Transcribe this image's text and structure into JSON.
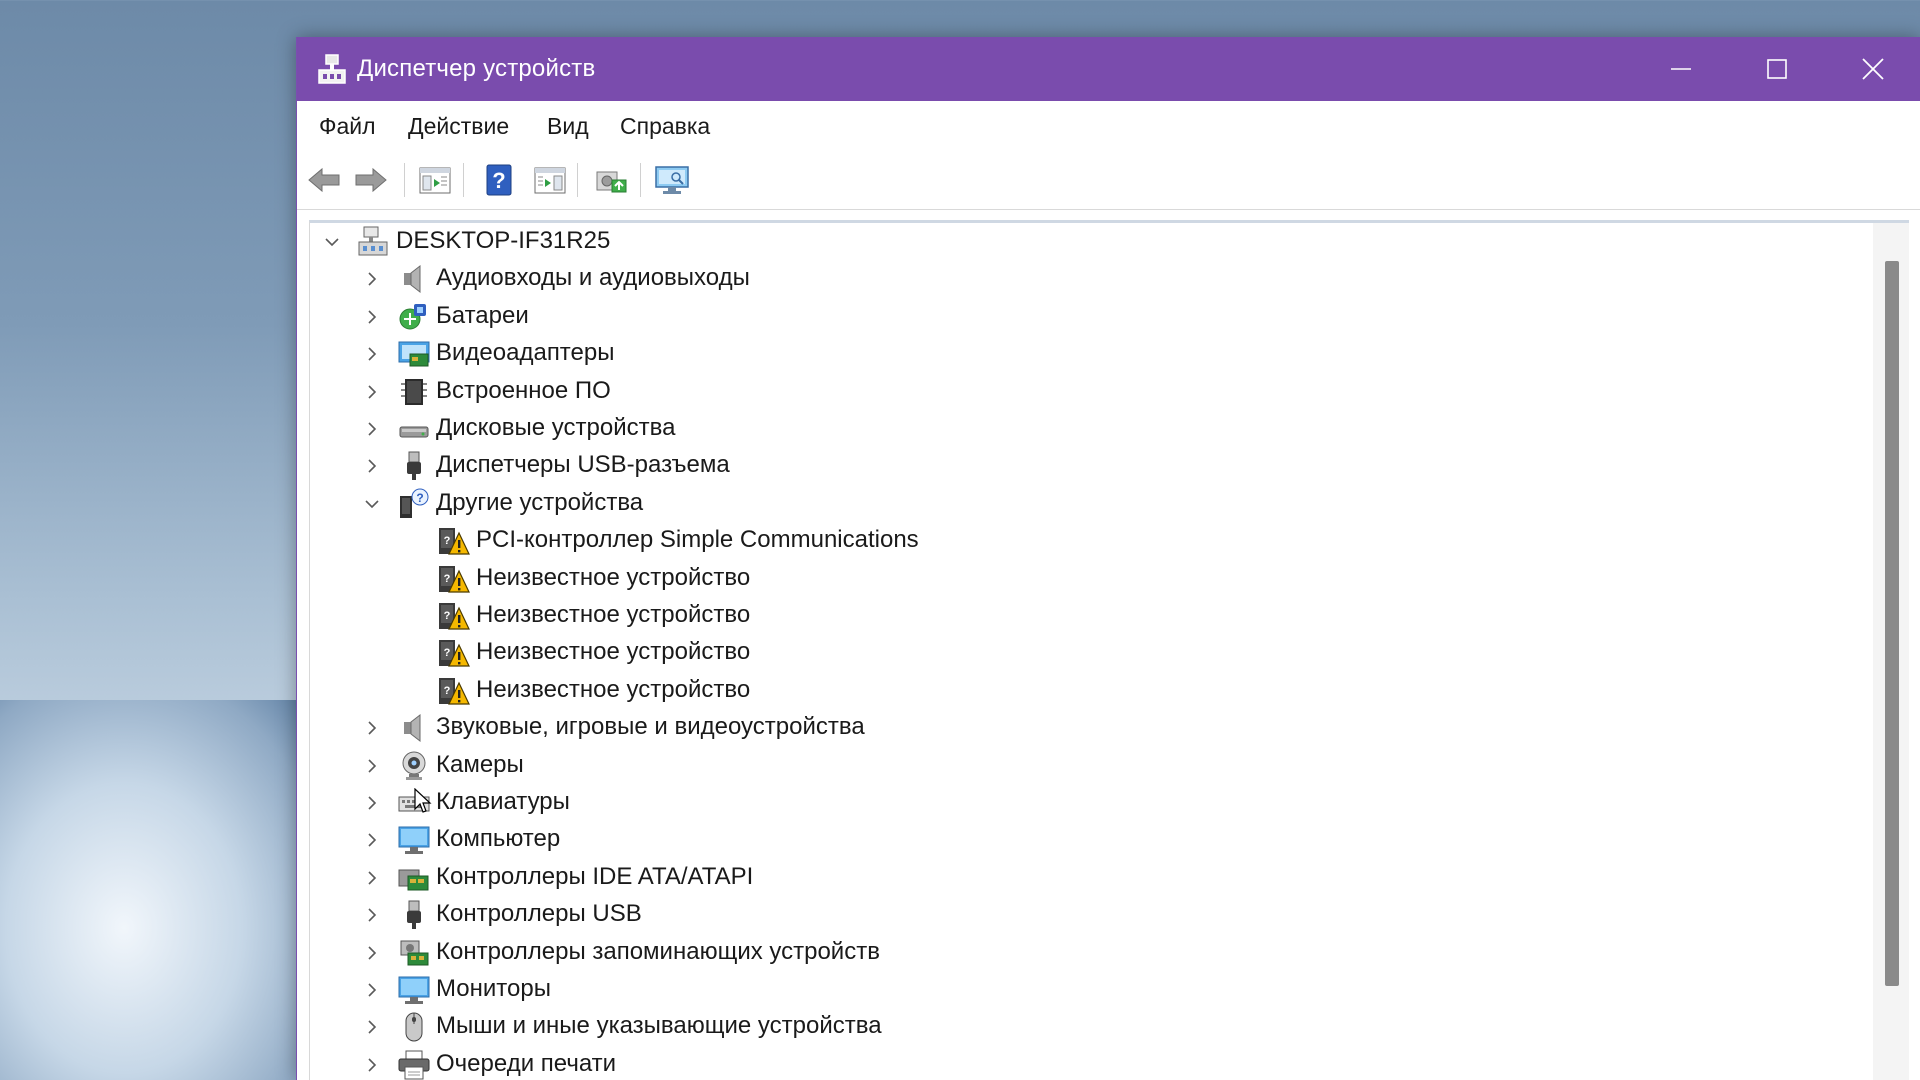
{
  "window": {
    "title": "Диспетчер устройств",
    "icon": "device-manager-icon",
    "accent": "#7a4cad"
  },
  "menu": [
    "Файл",
    "Действие",
    "Вид",
    "Справка"
  ],
  "toolbar": [
    "back-arrow-icon",
    "forward-arrow-icon",
    "properties-icon",
    "help-icon",
    "show-hidden-icon",
    "update-driver-icon",
    "scan-hardware-icon"
  ],
  "tree": {
    "root": "DESKTOP-IF31R25",
    "items": [
      {
        "label": "Аудиовходы и аудиовыходы",
        "icon": "speaker-icon",
        "expanded": false
      },
      {
        "label": "Батареи",
        "icon": "battery-icon",
        "expanded": false
      },
      {
        "label": "Видеоадаптеры",
        "icon": "display-adapter-icon",
        "expanded": false
      },
      {
        "label": "Встроенное ПО",
        "icon": "firmware-icon",
        "expanded": false
      },
      {
        "label": "Дисковые устройства",
        "icon": "disk-drive-icon",
        "expanded": false
      },
      {
        "label": "Диспетчеры USB-разъема",
        "icon": "usb-connector-icon",
        "expanded": false
      },
      {
        "label": "Другие устройства",
        "icon": "other-devices-icon",
        "expanded": true
      },
      {
        "label": "Звуковые, игровые и видеоустройства",
        "icon": "speaker-icon",
        "expanded": false
      },
      {
        "label": "Камеры",
        "icon": "camera-icon",
        "expanded": false
      },
      {
        "label": "Клавиатуры",
        "icon": "keyboard-icon",
        "expanded": false
      },
      {
        "label": "Компьютер",
        "icon": "computer-icon",
        "expanded": false
      },
      {
        "label": "Контроллеры IDE ATA/ATAPI",
        "icon": "ide-controller-icon",
        "expanded": false
      },
      {
        "label": "Контроллеры USB",
        "icon": "usb-icon",
        "expanded": false
      },
      {
        "label": "Контроллеры запоминающих устройств",
        "icon": "storage-controller-icon",
        "expanded": false
      },
      {
        "label": "Мониторы",
        "icon": "monitor-icon",
        "expanded": false
      },
      {
        "label": "Мыши и иные указывающие устройства",
        "icon": "mouse-icon",
        "expanded": false
      },
      {
        "label": "Очереди печати",
        "icon": "printer-icon",
        "expanded": false
      }
    ],
    "other_children": [
      "PCI-контроллер Simple Communications",
      "Неизвестное устройство",
      "Неизвестное устройство",
      "Неизвестное устройство",
      "Неизвестное устройство"
    ]
  }
}
